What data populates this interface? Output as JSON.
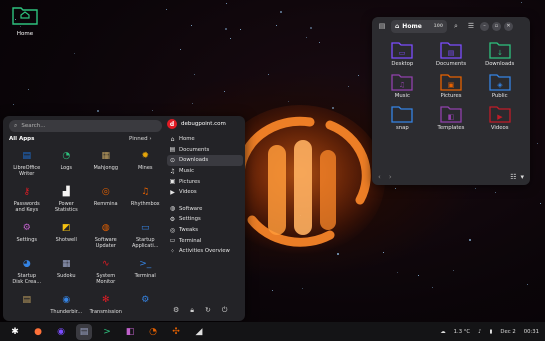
{
  "desktop": {
    "home_label": "Home"
  },
  "file_manager": {
    "path_label": "Home",
    "path_badge": "100",
    "folders": [
      {
        "label": "Desktop",
        "color": "#7c4dff",
        "glyph": "▭"
      },
      {
        "label": "Documents",
        "color": "#7c4dff",
        "glyph": "▤"
      },
      {
        "label": "Downloads",
        "color": "#2ec27e",
        "glyph": "↓"
      },
      {
        "label": "Music",
        "color": "#9141ac",
        "glyph": "♫"
      },
      {
        "label": "Pictures",
        "color": "#e66100",
        "glyph": "▣"
      },
      {
        "label": "Public",
        "color": "#3584e4",
        "glyph": "◈"
      },
      {
        "label": "snap",
        "color": "#3584e4",
        "glyph": ""
      },
      {
        "label": "Templates",
        "color": "#9141ac",
        "glyph": "◧"
      },
      {
        "label": "Videos",
        "color": "#c01c28",
        "glyph": "▶"
      }
    ]
  },
  "menu": {
    "search_placeholder": "Search...",
    "all_apps_label": "All Apps",
    "pinned_label": "Pinned",
    "apps": [
      {
        "label": "LibreOffice\nWriter",
        "glyph": "▤",
        "color": "#1c71d8"
      },
      {
        "label": "Logs",
        "glyph": "◔",
        "color": "#2ec27e"
      },
      {
        "label": "Mahjongg",
        "glyph": "▦",
        "color": "#c0a060"
      },
      {
        "label": "Mines",
        "glyph": "✹",
        "color": "#e5a50a"
      },
      {
        "label": "Passwords\nand Keys",
        "glyph": "⚷",
        "color": "#e01b24"
      },
      {
        "label": "Power\nStatistics",
        "glyph": "▟",
        "color": "#f6f5f4"
      },
      {
        "label": "Remmina",
        "glyph": "◎",
        "color": "#e66100"
      },
      {
        "label": "Rhythmbox",
        "glyph": "♫",
        "color": "#e66100"
      },
      {
        "label": "Settings",
        "glyph": "⚙",
        "color": "#c061cb"
      },
      {
        "label": "Shotwell",
        "glyph": "◩",
        "color": "#f5c211"
      },
      {
        "label": "Software\nUpdater",
        "glyph": "◍",
        "color": "#e66100"
      },
      {
        "label": "Startup\nApplicati...",
        "glyph": "▭",
        "color": "#3584e4"
      },
      {
        "label": "Startup\nDisk Crea...",
        "glyph": "◕",
        "color": "#3584e4"
      },
      {
        "label": "Sudoku",
        "glyph": "▦",
        "color": "#9aa3c4"
      },
      {
        "label": "System\nMonitor",
        "glyph": "∿",
        "color": "#e01b24"
      },
      {
        "label": "Terminal",
        "glyph": ">_",
        "color": "#3584e4"
      },
      {
        "label": "",
        "glyph": "▤",
        "color": "#c0a060"
      },
      {
        "label": "Thunderbir...",
        "glyph": "◉",
        "color": "#3584e4"
      },
      {
        "label": "Transmission",
        "glyph": "✻",
        "color": "#e01b24"
      },
      {
        "label": "",
        "glyph": "⚙",
        "color": "#3584e4"
      }
    ],
    "user_initial": "d",
    "user_name": "debugpoint.com",
    "places": [
      {
        "label": "Home",
        "glyph": "⌂"
      },
      {
        "label": "Documents",
        "glyph": "▤"
      },
      {
        "label": "Downloads",
        "glyph": "⊙"
      },
      {
        "label": "Music",
        "glyph": "♫"
      },
      {
        "label": "Pictures",
        "glyph": "▣"
      },
      {
        "label": "Videos",
        "glyph": "▶"
      }
    ],
    "system": [
      {
        "label": "Software",
        "glyph": "◍"
      },
      {
        "label": "Settings",
        "glyph": "⚙"
      },
      {
        "label": "Tweaks",
        "glyph": "◎"
      },
      {
        "label": "Terminal",
        "glyph": "▭"
      },
      {
        "label": "Activities Overview",
        "glyph": "⁘"
      }
    ]
  },
  "taskbar": {
    "apps": [
      {
        "name": "menu",
        "glyph": "✱",
        "color": "#ffffff",
        "bg": "transparent"
      },
      {
        "name": "firefox",
        "glyph": "●",
        "color": "#ff7139",
        "bg": "transparent"
      },
      {
        "name": "browser",
        "glyph": "◉",
        "color": "#7c4dff",
        "bg": "transparent"
      },
      {
        "name": "files",
        "glyph": "▤",
        "color": "#9aa3c4",
        "bg": "#3a3a40"
      },
      {
        "name": "terminal",
        "glyph": ">",
        "color": "#2ec27e",
        "bg": "transparent"
      },
      {
        "name": "store",
        "glyph": "◧",
        "color": "#c061cb",
        "bg": "transparent"
      },
      {
        "name": "music",
        "glyph": "◔",
        "color": "#e66100",
        "bg": "transparent"
      },
      {
        "name": "settings",
        "glyph": "✣",
        "color": "#e66100",
        "bg": "transparent"
      },
      {
        "name": "editor",
        "glyph": "◢",
        "color": "#e0e0e0",
        "bg": "transparent"
      }
    ],
    "temperature": "1.3 °C",
    "date": "Dec 2",
    "time": "00:31"
  },
  "colors": {
    "accent": "#e66100",
    "menu_bg": "#232327",
    "fm_bg": "#2c2c30"
  }
}
